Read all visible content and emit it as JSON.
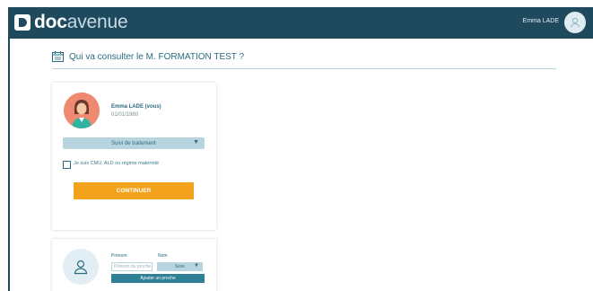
{
  "header": {
    "brand_strong": "doc",
    "brand_light": "avenue",
    "user_name": "Emma LADE"
  },
  "page": {
    "title": "Qui va consulter le M. FORMATION TEST ?"
  },
  "patient_card": {
    "name": "Emma LADE (vous)",
    "dob": "01/01/1980",
    "reason_select": "Suivi de traitement",
    "checkbox_label": "Je suis CMU, ALD ou régime maternité",
    "checkbox_checked": false,
    "continue_label": "CONTINUER"
  },
  "relative_card": {
    "prenom_label": "Prénom",
    "nom_label": "Nom",
    "prenom_placeholder": "Prénom du proche",
    "nom_select": "Sexe",
    "add_label": "Ajouter un proche"
  },
  "colors": {
    "header_bg": "#1f4a5e",
    "accent": "#2b6c82",
    "cta": "#f2a21b",
    "select_bg": "#b8d5df"
  }
}
